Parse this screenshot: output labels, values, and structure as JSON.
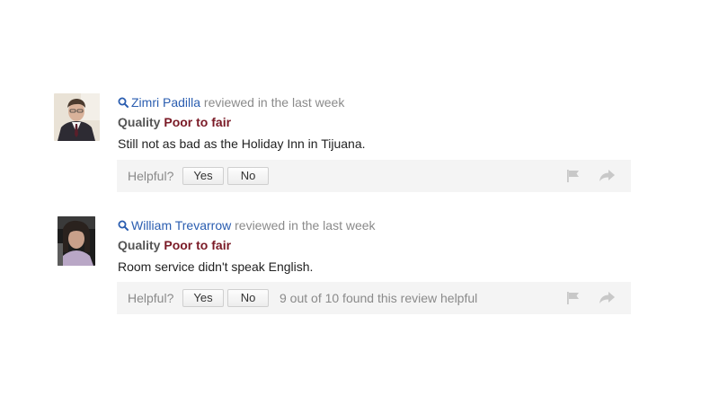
{
  "reviews": [
    {
      "author": "Zimri Padilla",
      "reviewed_text": "reviewed in the last week",
      "quality_label": "Quality",
      "quality_value": "Poor to fair",
      "text": "Still not as bad as the Holiday Inn in Tijuana.",
      "helpful_label": "Helpful?",
      "yes_label": "Yes",
      "no_label": "No",
      "found_helpful": ""
    },
    {
      "author": "William Trevarrow",
      "reviewed_text": "reviewed in the last week",
      "quality_label": "Quality",
      "quality_value": "Poor to fair",
      "text": "Room service didn't speak English.",
      "helpful_label": "Helpful?",
      "yes_label": "Yes",
      "no_label": "No",
      "found_helpful": "9 out of 10 found this review helpful"
    }
  ],
  "icons": {
    "author_search": "magnifier-icon",
    "report": "flag-icon",
    "share": "share-arrow-icon"
  },
  "colors": {
    "author_link": "#2a5db0",
    "quality_value": "#7a1a26",
    "muted_text": "#8a8a8a",
    "helpful_bar_bg": "#f4f4f4"
  }
}
